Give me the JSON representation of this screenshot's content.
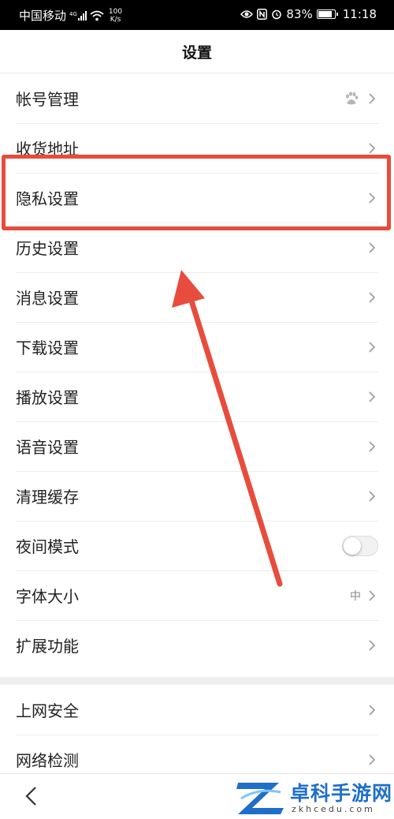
{
  "status_bar": {
    "carrier": "中国移动",
    "network": "4G",
    "speed_value": "100",
    "speed_unit": "K/s",
    "battery": "83%",
    "time": "11:18"
  },
  "header": {
    "title": "设置"
  },
  "settings": {
    "account": {
      "label": "帐号管理",
      "icon": "baidu-paw-icon"
    },
    "address": {
      "label": "收货地址"
    },
    "privacy": {
      "label": "隐私设置"
    },
    "history": {
      "label": "历史设置"
    },
    "message": {
      "label": "消息设置"
    },
    "download": {
      "label": "下载设置"
    },
    "playback": {
      "label": "播放设置"
    },
    "voice": {
      "label": "语音设置"
    },
    "cache": {
      "label": "清理缓存"
    },
    "night": {
      "label": "夜间模式",
      "enabled": false
    },
    "font": {
      "label": "字体大小",
      "value": "中"
    },
    "extensions": {
      "label": "扩展功能"
    },
    "security": {
      "label": "上网安全"
    },
    "network_check": {
      "label": "网络检测"
    }
  },
  "annotation": {
    "color": "#e74c3c"
  },
  "watermark": {
    "name": "卓科手游网",
    "domain": "zkhcedu.com"
  }
}
